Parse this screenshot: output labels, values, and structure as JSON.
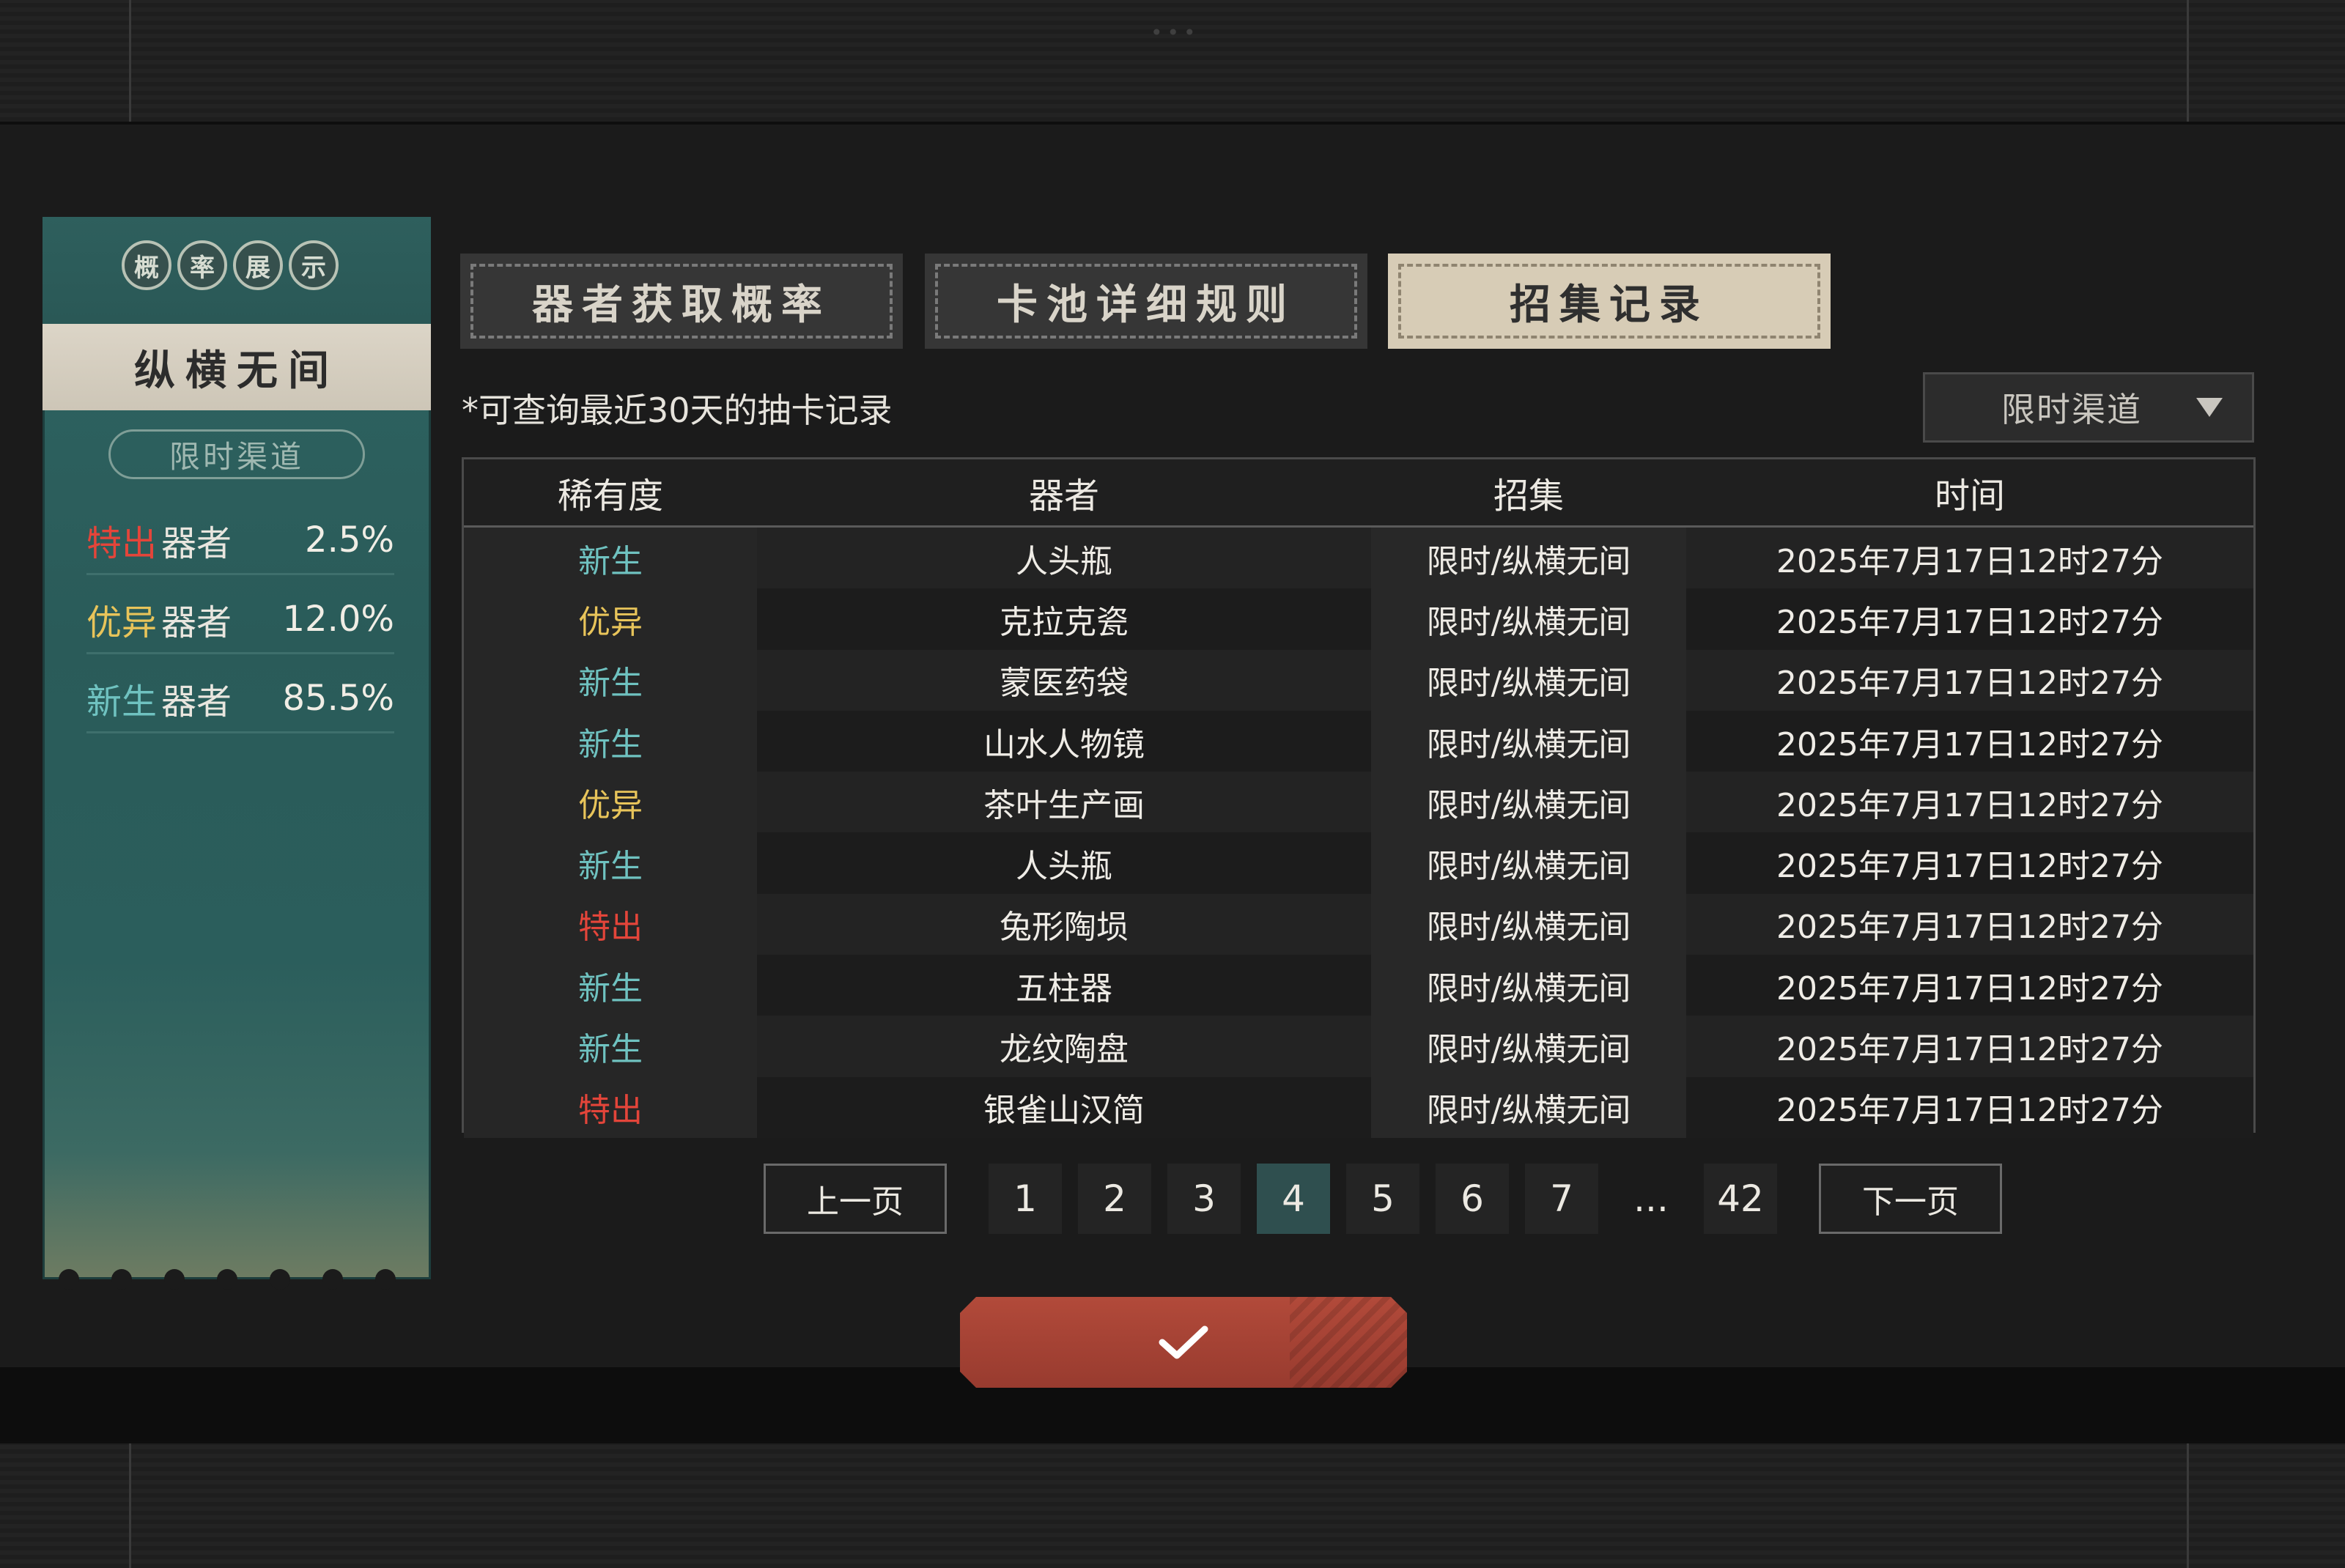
{
  "side_panel": {
    "seal_chars": [
      "概",
      "率",
      "展",
      "示"
    ],
    "pool_name": "纵横无间",
    "channel": "限时渠道",
    "rates": [
      {
        "rarity": "特出",
        "rarity_color": "#e4453a",
        "label": "器者",
        "percent": "2.5%"
      },
      {
        "rarity": "优异",
        "rarity_color": "#e8c45a",
        "label": "器者",
        "percent": "12.0%"
      },
      {
        "rarity": "新生",
        "rarity_color": "#6fc2c0",
        "label": "器者",
        "percent": "85.5%"
      }
    ]
  },
  "tabs": [
    {
      "label": "器者获取概率",
      "active": false
    },
    {
      "label": "卡池详细规则",
      "active": false
    },
    {
      "label": "招集记录",
      "active": true
    }
  ],
  "note": "*可查询最近30天的抽卡记录",
  "filter": {
    "selected": "限时渠道",
    "icon": "caret-down-icon"
  },
  "table": {
    "headers": [
      "稀有度",
      "器者",
      "招集",
      "时间"
    ],
    "rarity_colors": {
      "新生": "#6fc2c0",
      "优异": "#e8c45a",
      "特出": "#e4453a"
    },
    "rows": [
      {
        "rarity": "新生",
        "name": "人头瓶",
        "pool": "限时/纵横无间",
        "time": "2025年7月17日12时27分"
      },
      {
        "rarity": "优异",
        "name": "克拉克瓷",
        "pool": "限时/纵横无间",
        "time": "2025年7月17日12时27分"
      },
      {
        "rarity": "新生",
        "name": "蒙医药袋",
        "pool": "限时/纵横无间",
        "time": "2025年7月17日12时27分"
      },
      {
        "rarity": "新生",
        "name": "山水人物镜",
        "pool": "限时/纵横无间",
        "time": "2025年7月17日12时27分"
      },
      {
        "rarity": "优异",
        "name": "茶叶生产画",
        "pool": "限时/纵横无间",
        "time": "2025年7月17日12时27分"
      },
      {
        "rarity": "新生",
        "name": "人头瓶",
        "pool": "限时/纵横无间",
        "time": "2025年7月17日12时27分"
      },
      {
        "rarity": "特出",
        "name": "兔形陶埙",
        "pool": "限时/纵横无间",
        "time": "2025年7月17日12时27分"
      },
      {
        "rarity": "新生",
        "name": "五柱器",
        "pool": "限时/纵横无间",
        "time": "2025年7月17日12时27分"
      },
      {
        "rarity": "新生",
        "name": "龙纹陶盘",
        "pool": "限时/纵横无间",
        "time": "2025年7月17日12时27分"
      },
      {
        "rarity": "特出",
        "name": "银雀山汉简",
        "pool": "限时/纵横无间",
        "time": "2025年7月17日12时27分"
      }
    ]
  },
  "pagination": {
    "prev_label": "上一页",
    "next_label": "下一页",
    "pages": [
      "1",
      "2",
      "3",
      "4",
      "5",
      "6",
      "7",
      "...",
      "42"
    ],
    "current": "4"
  },
  "confirm": {
    "icon": "check-icon"
  },
  "top_dots": "•••"
}
